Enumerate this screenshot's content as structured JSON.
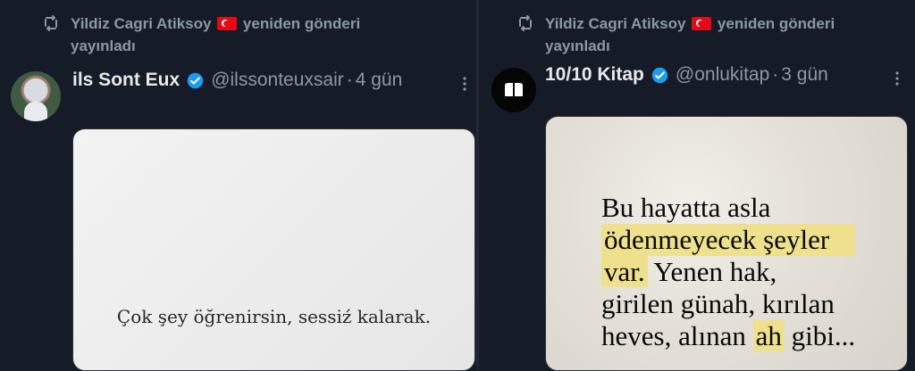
{
  "left_tweet": {
    "retweeted_by": "Yildiz Cagri Atiksoy",
    "retweet_action": "yeniden gönderi",
    "retweet_action_2": "yayınladı",
    "display_name": "ils Sont Eux",
    "handle": "@ilssonteuxsair",
    "separator": "·",
    "time": "4 gün",
    "image_text": "Çok şey öğrenirsin, sessiź kalarak."
  },
  "right_tweet": {
    "retweeted_by": "Yildiz Cagri Atiksoy",
    "retweet_action": "yeniden gönderi",
    "retweet_action_2": "yayınladı",
    "display_name": "10/10 Kitap",
    "handle": "@onlukitap",
    "separator": "·",
    "time": "3 gün",
    "image_lines": [
      "Bu hayatta asla",
      "ödenmeyecek şeyler",
      "var.",
      " Yenen hak,",
      "girilen günah, kırılan",
      "heves, alınan ",
      "ah",
      " gibi..."
    ]
  },
  "colors": {
    "background": "#151c27",
    "muted_text": "#8b98a5",
    "verified_blue": "#1d9bf0",
    "highlight": "#eee08c"
  },
  "icons": [
    "retweet-icon",
    "verified-icon",
    "more-icon",
    "flag-icon"
  ]
}
